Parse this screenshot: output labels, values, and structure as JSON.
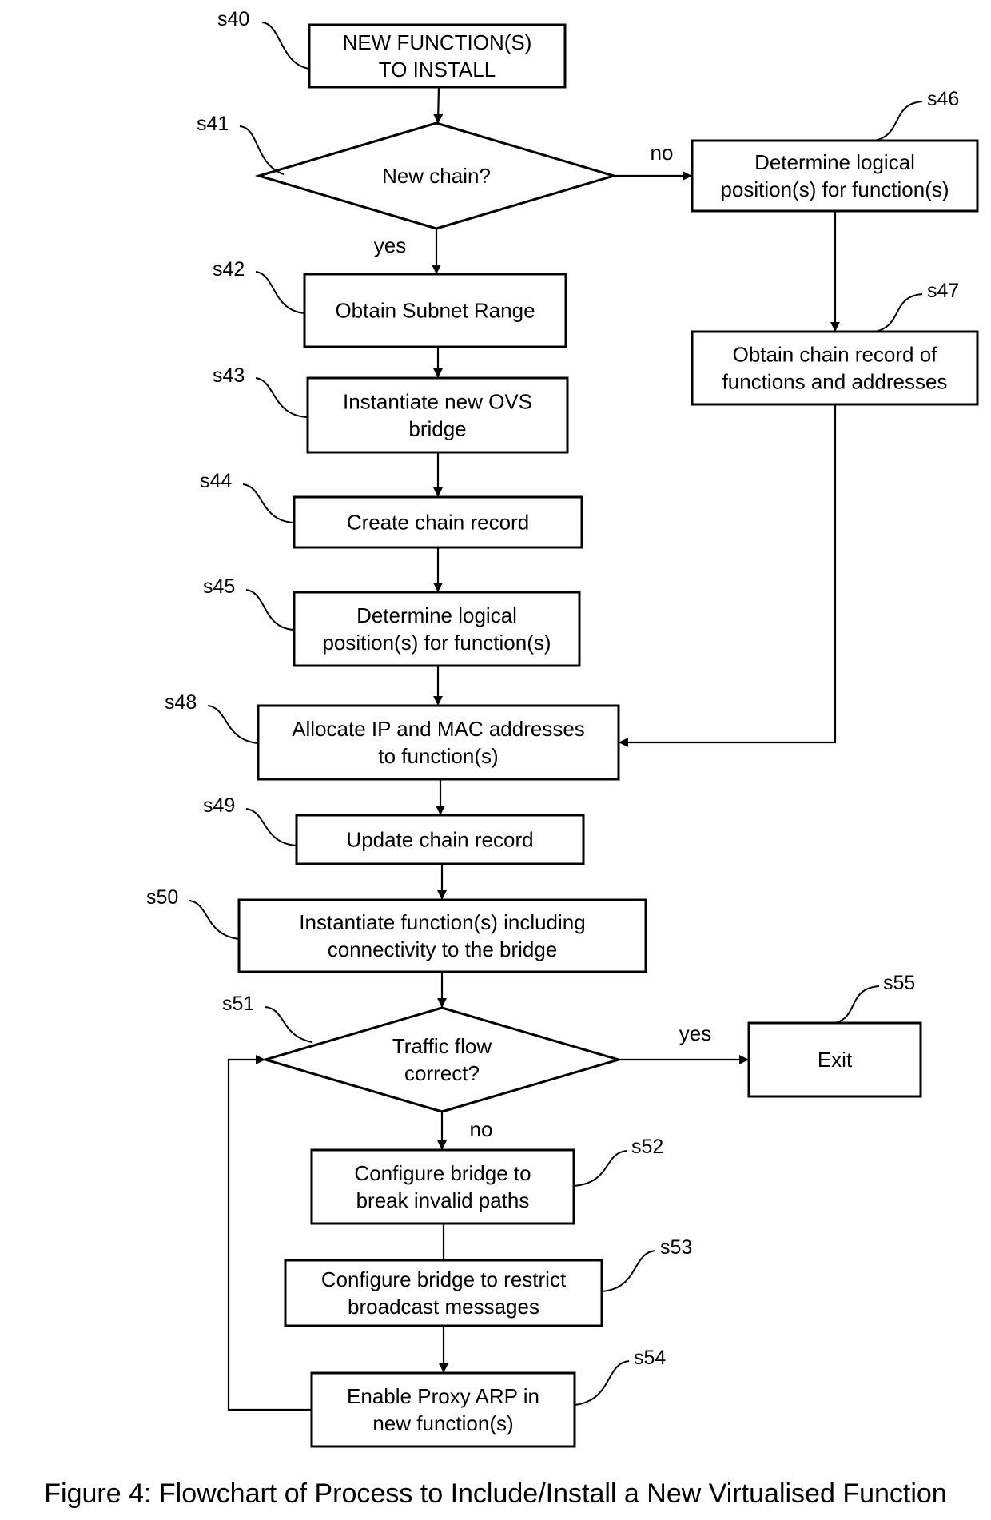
{
  "figure": {
    "caption": "Figure 4: Flowchart of Process to Include/Install a New Virtualised Function"
  },
  "nodes": [
    {
      "id": "s40",
      "type": "box",
      "lines": [
        "NEW FUNCTION(S)",
        "TO INSTALL"
      ]
    },
    {
      "id": "s41",
      "type": "decision",
      "lines": [
        "New chain?"
      ]
    },
    {
      "id": "s42",
      "type": "box",
      "lines": [
        "Obtain Subnet Range"
      ]
    },
    {
      "id": "s43",
      "type": "box",
      "lines": [
        "Instantiate new OVS",
        "bridge"
      ]
    },
    {
      "id": "s44",
      "type": "box",
      "lines": [
        "Create chain record"
      ]
    },
    {
      "id": "s45",
      "type": "box",
      "lines": [
        "Determine logical",
        "position(s) for function(s)"
      ]
    },
    {
      "id": "s46",
      "type": "box",
      "lines": [
        "Determine logical",
        "position(s) for function(s)"
      ]
    },
    {
      "id": "s47",
      "type": "box",
      "lines": [
        "Obtain chain record of",
        "functions and addresses"
      ]
    },
    {
      "id": "s48",
      "type": "box",
      "lines": [
        "Allocate IP and MAC addresses",
        "to function(s)"
      ]
    },
    {
      "id": "s49",
      "type": "box",
      "lines": [
        "Update chain record"
      ]
    },
    {
      "id": "s50",
      "type": "box",
      "lines": [
        "Instantiate function(s) including",
        "connectivity to the bridge"
      ]
    },
    {
      "id": "s51",
      "type": "decision",
      "lines": [
        "Traffic flow",
        "correct?"
      ]
    },
    {
      "id": "s52",
      "type": "box",
      "lines": [
        "Configure bridge to",
        "break invalid paths"
      ]
    },
    {
      "id": "s53",
      "type": "box",
      "lines": [
        "Configure bridge to restrict",
        "broadcast messages"
      ]
    },
    {
      "id": "s54",
      "type": "box",
      "lines": [
        "Enable Proxy ARP in",
        "new function(s)"
      ]
    },
    {
      "id": "s55",
      "type": "box",
      "lines": [
        "Exit"
      ]
    }
  ],
  "edges": [
    {
      "from": "s40",
      "to": "s41",
      "label": ""
    },
    {
      "from": "s41",
      "to": "s42",
      "label": "yes"
    },
    {
      "from": "s41",
      "to": "s46",
      "label": "no"
    },
    {
      "from": "s42",
      "to": "s43",
      "label": ""
    },
    {
      "from": "s43",
      "to": "s44",
      "label": ""
    },
    {
      "from": "s44",
      "to": "s45",
      "label": ""
    },
    {
      "from": "s45",
      "to": "s48",
      "label": ""
    },
    {
      "from": "s46",
      "to": "s47",
      "label": ""
    },
    {
      "from": "s47",
      "to": "s48",
      "label": ""
    },
    {
      "from": "s48",
      "to": "s49",
      "label": ""
    },
    {
      "from": "s49",
      "to": "s50",
      "label": ""
    },
    {
      "from": "s50",
      "to": "s51",
      "label": ""
    },
    {
      "from": "s51",
      "to": "s55",
      "label": "yes"
    },
    {
      "from": "s51",
      "to": "s52",
      "label": "no"
    },
    {
      "from": "s52",
      "to": "s53",
      "label": ""
    },
    {
      "from": "s53",
      "to": "s54",
      "label": ""
    },
    {
      "from": "s54",
      "to": "s51",
      "label": ""
    }
  ]
}
